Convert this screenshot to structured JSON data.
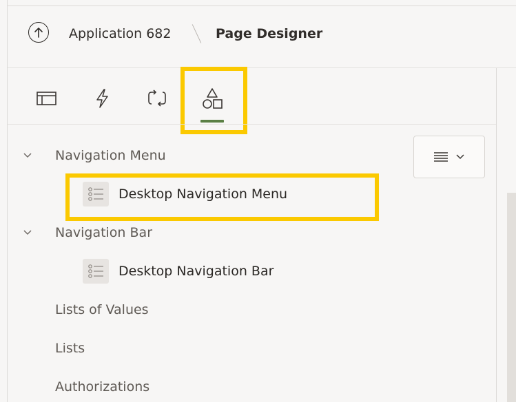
{
  "header": {
    "app_label": "Application 682",
    "page_label": "Page Designer",
    "up_icon": "arrow-up-circle-icon"
  },
  "tabs": [
    {
      "name": "rendering",
      "icon": "layout-icon",
      "active": false
    },
    {
      "name": "dynamic-actions",
      "icon": "lightning-icon",
      "active": false
    },
    {
      "name": "processing",
      "icon": "refresh-icon",
      "active": false
    },
    {
      "name": "shared-components",
      "icon": "shapes-icon",
      "active": true
    }
  ],
  "colors": {
    "highlight": "#fbc900",
    "active_tab_underline": "#5a7f44"
  },
  "tree": {
    "groups": [
      {
        "label": "Navigation Menu",
        "expanded": true,
        "items": [
          {
            "label": "Desktop Navigation Menu",
            "icon": "list-icon"
          }
        ]
      },
      {
        "label": "Navigation Bar",
        "expanded": true,
        "items": [
          {
            "label": "Desktop Navigation Bar",
            "icon": "list-icon"
          }
        ]
      }
    ],
    "top_items": [
      "Lists of Values",
      "Lists",
      "Authorizations"
    ]
  },
  "menu_button": {
    "icon": "hamburger-icon",
    "chevron": "chevron-down-icon"
  }
}
